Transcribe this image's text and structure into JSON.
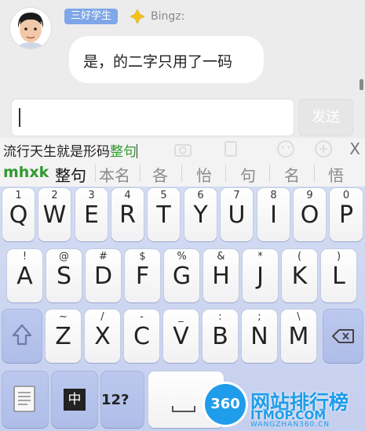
{
  "chat": {
    "title_badge": "三好学生",
    "sender": "Bingz:",
    "message": "是，的二字只用了一码"
  },
  "composer": {
    "input_value": "",
    "send_label": "发送"
  },
  "composition": {
    "text": "流行天生就是形码",
    "highlight": "整句",
    "close_label": "X"
  },
  "candidates": {
    "code": "mhxk",
    "items": [
      "整句",
      "本名",
      "各",
      "怡",
      "句",
      "名",
      "悟"
    ]
  },
  "keyboard": {
    "row1": [
      {
        "sub": "1",
        "main": "Q"
      },
      {
        "sub": "2",
        "main": "W"
      },
      {
        "sub": "3",
        "main": "E"
      },
      {
        "sub": "4",
        "main": "R"
      },
      {
        "sub": "5",
        "main": "T"
      },
      {
        "sub": "6",
        "main": "Y"
      },
      {
        "sub": "7",
        "main": "U"
      },
      {
        "sub": "8",
        "main": "I"
      },
      {
        "sub": "9",
        "main": "O"
      },
      {
        "sub": "0",
        "main": "P"
      }
    ],
    "row2": [
      {
        "sub": "!",
        "main": "A"
      },
      {
        "sub": "@",
        "main": "S"
      },
      {
        "sub": "#",
        "main": "D"
      },
      {
        "sub": "$",
        "main": "F"
      },
      {
        "sub": "%",
        "main": "G"
      },
      {
        "sub": "&",
        "main": "H"
      },
      {
        "sub": "*",
        "main": "J"
      },
      {
        "sub": "(",
        "main": "K"
      },
      {
        "sub": ")",
        "main": "L"
      }
    ],
    "row3": [
      {
        "sub": "~",
        "main": "Z"
      },
      {
        "sub": "/",
        "main": "X"
      },
      {
        "sub": "-",
        "main": "C"
      },
      {
        "sub": "_",
        "main": "V"
      },
      {
        "sub": ":",
        "main": "B"
      },
      {
        "sub": ";",
        "main": "N"
      },
      {
        "sub": "\\",
        "main": "M"
      }
    ],
    "mode_zh": "中",
    "num_label": "12?"
  },
  "watermark": {
    "badge": "360",
    "title": "网站排行榜",
    "domain": "ITMOP.COM",
    "sub": "WANGZHAN360.CN"
  },
  "colors": {
    "accent_green": "#2f9a2f",
    "badge_blue": "#7ea6e8",
    "keyboard_bg": "#c5cfee",
    "watermark_blue": "#1f9dea"
  }
}
